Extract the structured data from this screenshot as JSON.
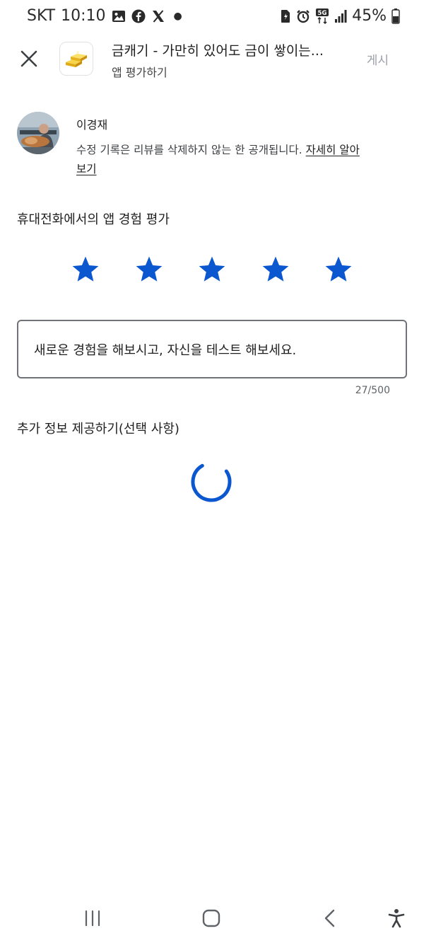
{
  "status_bar": {
    "carrier": "SKT",
    "time": "10:10",
    "battery": "45%",
    "network": "5G",
    "icons_left": [
      "gallery-icon",
      "facebook-icon",
      "x-icon"
    ],
    "icons_right": [
      "sim-icon",
      "alarm-icon",
      "5g-icon",
      "signal-icon",
      "battery-icon"
    ]
  },
  "header": {
    "close_icon": "close-icon",
    "app_title": "금캐기 - 가만히 있어도 금이 쌓이는...",
    "subtitle": "앱 평가하기",
    "post_label": "게시"
  },
  "user": {
    "name": "이경재",
    "notice": "수정 기록은 리뷰를 삭제하지 않는 한 공개됩니다.",
    "learn_more": "자세히 알아보기"
  },
  "rating": {
    "label": "휴대전화에서의 앱 경험 평가",
    "value": 5,
    "max": 5,
    "star_color": "#0b57d0"
  },
  "review": {
    "text": "새로운 경험을 해보시고, 자신을 테스트 해보세요.",
    "count": "27/500"
  },
  "extra": {
    "label": "추가 정보 제공하기(선택 사항)"
  },
  "nav_bar": {
    "buttons": [
      "recent-apps-icon",
      "home-icon",
      "back-icon",
      "accessibility-icon"
    ]
  },
  "colors": {
    "accent": "#0b57d0",
    "text": "#1f1f1f",
    "muted": "#9aa0a6"
  }
}
